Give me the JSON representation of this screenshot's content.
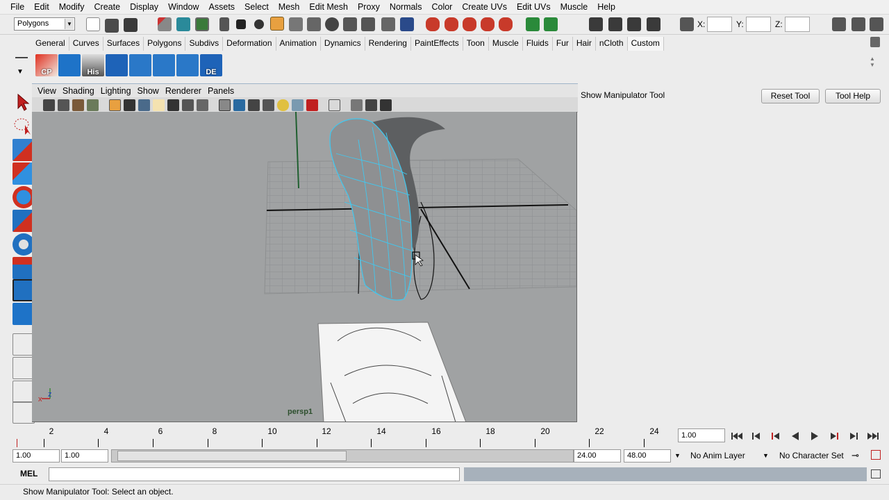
{
  "menubar": [
    "File",
    "Edit",
    "Modify",
    "Create",
    "Display",
    "Window",
    "Assets",
    "Select",
    "Mesh",
    "Edit Mesh",
    "Proxy",
    "Normals",
    "Color",
    "Create UVs",
    "Edit UVs",
    "Muscle",
    "Help"
  ],
  "status_line": {
    "mode": "Polygons",
    "x_label": "X:",
    "y_label": "Y:",
    "z_label": "Z:",
    "x_value": "",
    "y_value": "",
    "z_value": ""
  },
  "shelf": {
    "tabs": [
      "General",
      "Curves",
      "Surfaces",
      "Polygons",
      "Subdivs",
      "Deformation",
      "Animation",
      "Dynamics",
      "Rendering",
      "PaintEffects",
      "Toon",
      "Muscle",
      "Fluids",
      "Fur",
      "Hair",
      "nCloth",
      "Custom"
    ],
    "active_tab": "Custom",
    "buttons": [
      "CP",
      "",
      "His",
      "",
      "",
      "",
      "",
      "DE"
    ]
  },
  "panel": {
    "menu": [
      "View",
      "Shading",
      "Lighting",
      "Show",
      "Renderer",
      "Panels"
    ],
    "camera_label": "persp1",
    "axis_x": "x",
    "axis_z": "z"
  },
  "tool_settings": {
    "title": "Show Manipulator Tool",
    "reset_label": "Reset Tool",
    "help_label": "Tool Help"
  },
  "timeline": {
    "ticks": [
      "2",
      "4",
      "6",
      "8",
      "10",
      "12",
      "14",
      "16",
      "18",
      "20",
      "22",
      "24"
    ],
    "current_frame": "1.00"
  },
  "range": {
    "start_min": "1.00",
    "start": "1.00",
    "end": "24.00",
    "end_max": "48.00",
    "anim_layer": "No Anim Layer",
    "character_set": "No Character Set"
  },
  "command_line": {
    "label": "MEL",
    "input": ""
  },
  "help_line": "Show Manipulator Tool: Select an object.",
  "colors": {
    "viewport_bg": "#a0a2a3",
    "wire_selected": "#40c8f0",
    "icon_blue": "#1e73c8",
    "icon_red": "#d03028",
    "result_bg": "#a7b1bb"
  }
}
